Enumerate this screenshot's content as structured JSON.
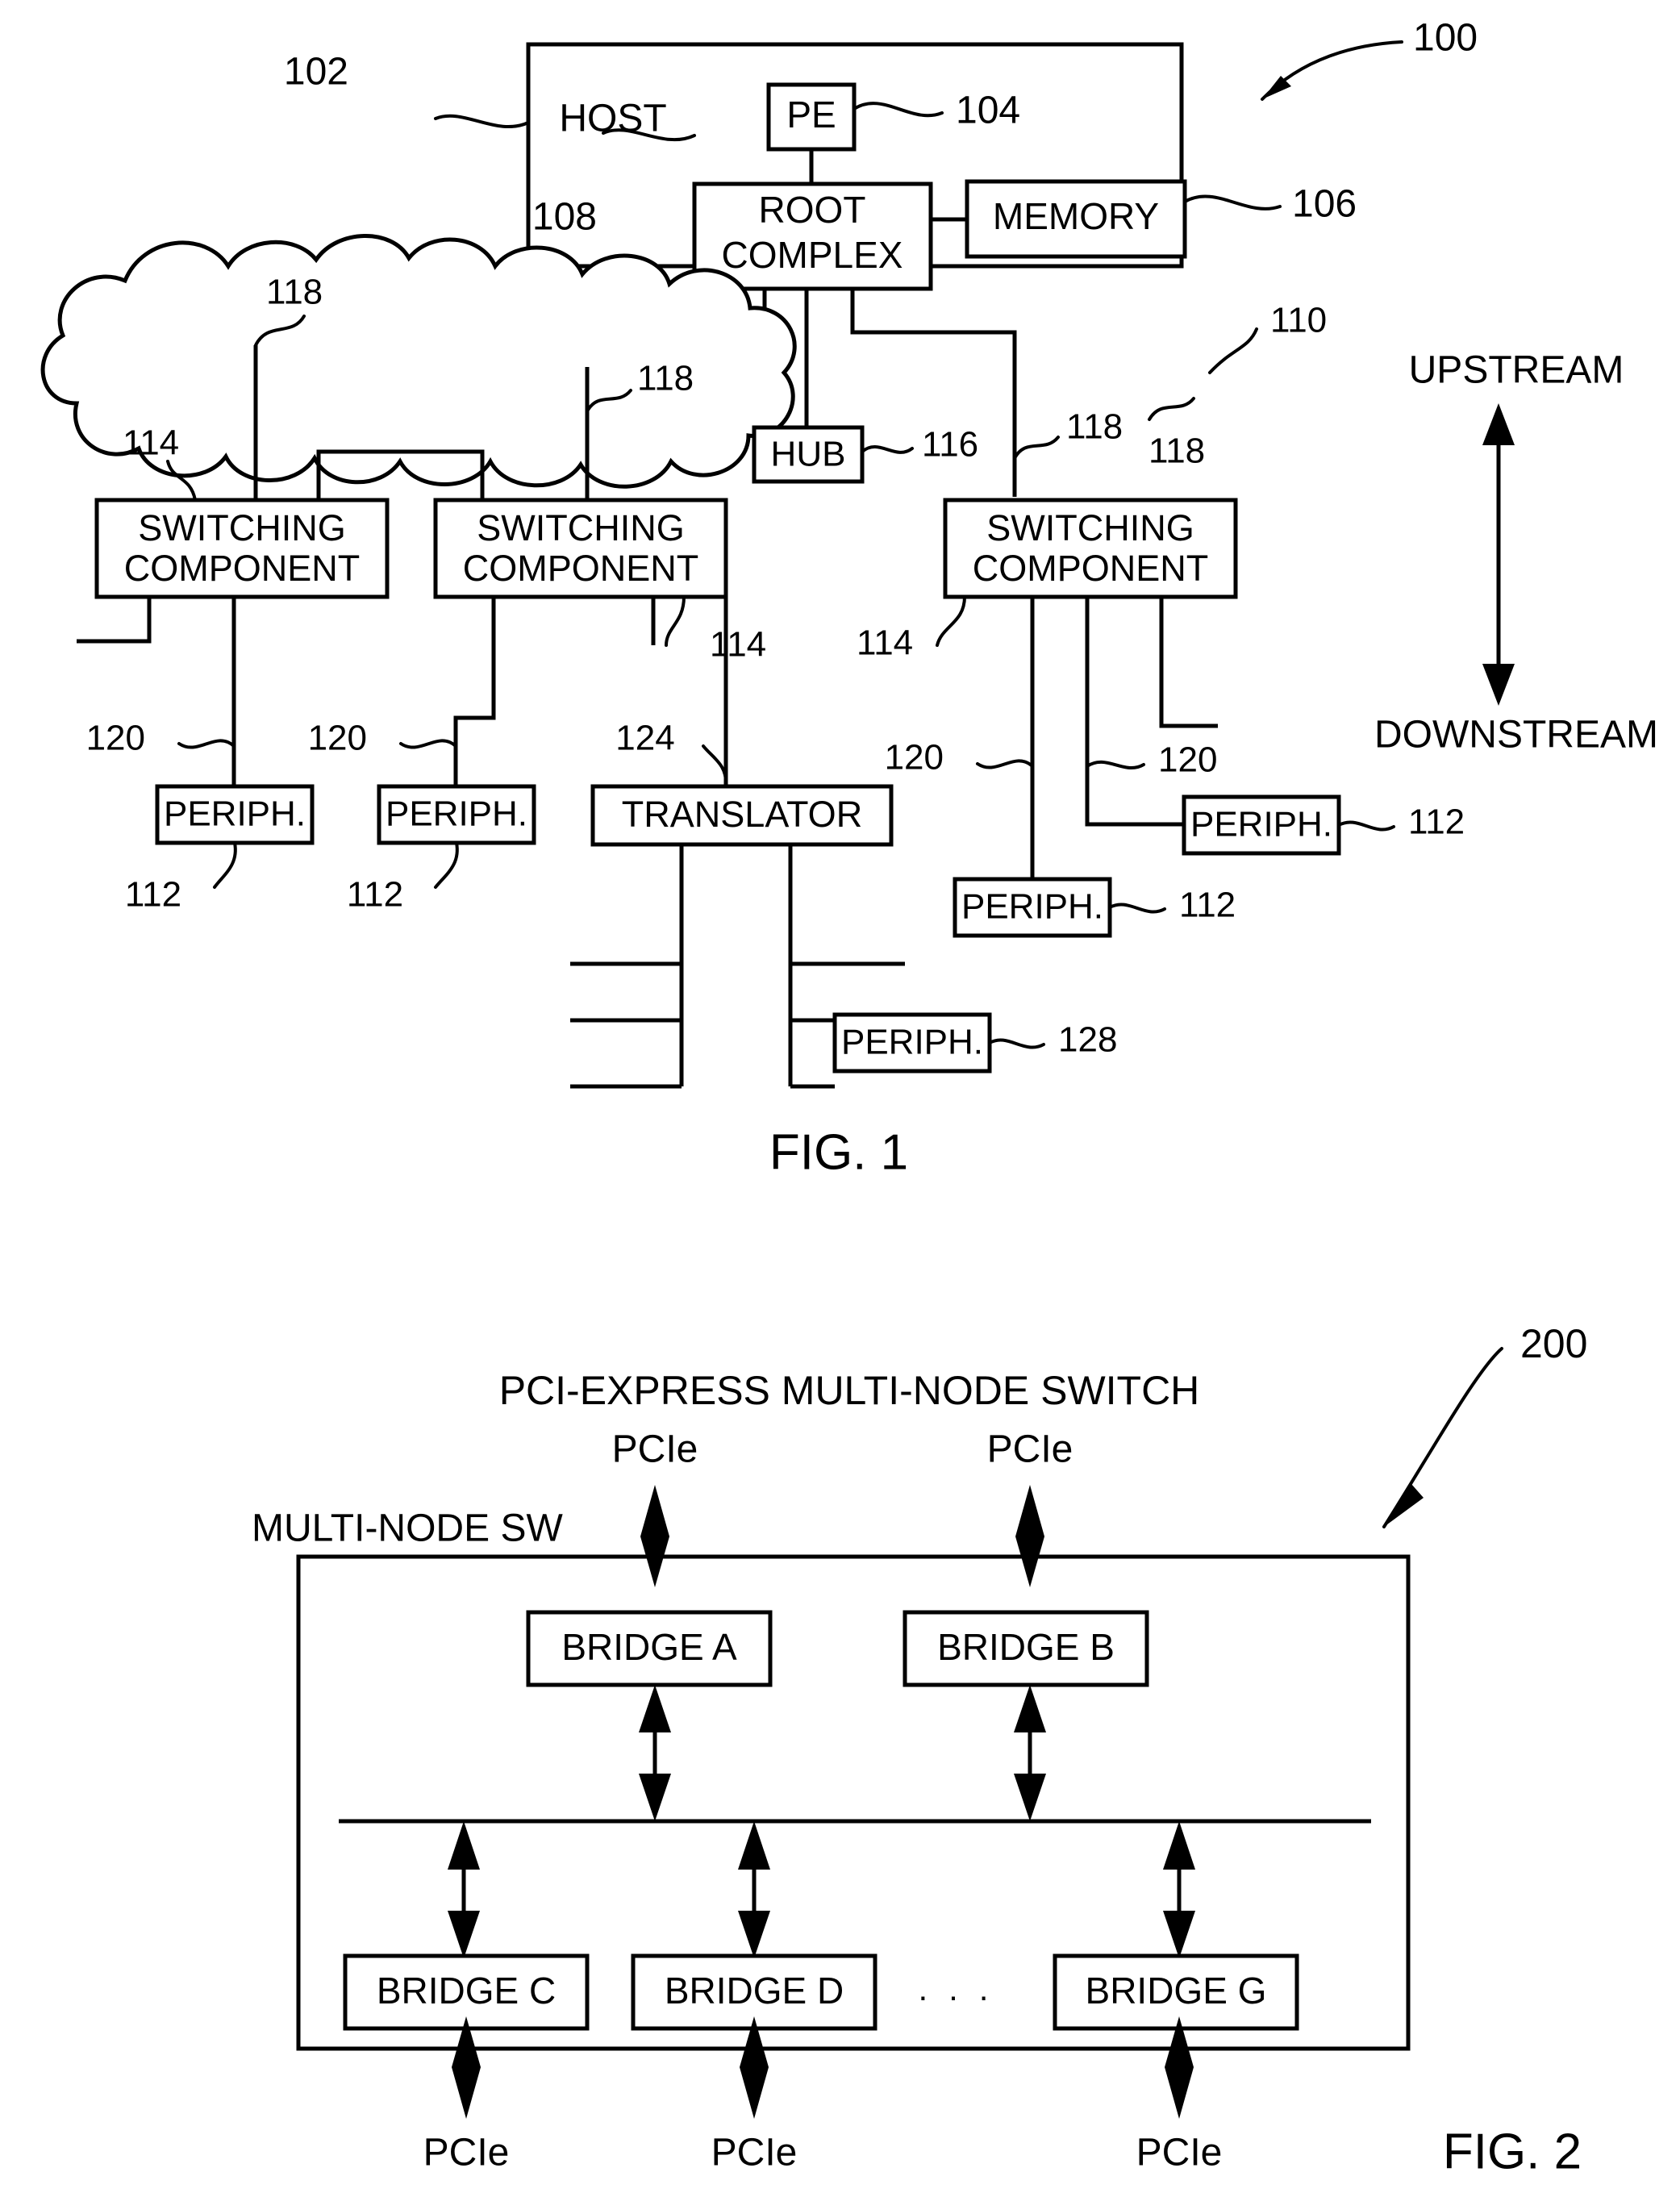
{
  "figure1": {
    "caption": "FIG. 1",
    "ref_system": "100",
    "host": {
      "label": "HOST",
      "ref": "102"
    },
    "pe": {
      "label": "PE",
      "ref": "104"
    },
    "root_complex": {
      "label_line1": "ROOT",
      "label_line2": "COMPLEX",
      "ref": "108"
    },
    "memory": {
      "label": "MEMORY",
      "ref": "106"
    },
    "fabric": {
      "ref": "110"
    },
    "hub": {
      "label": "HUB",
      "ref": "116"
    },
    "switching_components": [
      {
        "label_line1": "SWITCHING",
        "label_line2": "COMPONENT",
        "ref": "114"
      },
      {
        "label_line1": "SWITCHING",
        "label_line2": "COMPONENT",
        "ref": "114"
      },
      {
        "label_line1": "SWITCHING",
        "label_line2": "COMPONENT",
        "ref": "114"
      }
    ],
    "link_refs_upstream": [
      "118",
      "118",
      "118",
      "118"
    ],
    "link_refs_downstream": [
      "120",
      "120",
      "120",
      "120"
    ],
    "peripherals": [
      {
        "label": "PERIPH.",
        "ref": "112"
      },
      {
        "label": "PERIPH.",
        "ref": "112"
      },
      {
        "label": "PERIPH.",
        "ref": "112"
      },
      {
        "label": "PERIPH.",
        "ref": "112"
      },
      {
        "label": "PERIPH.",
        "ref": "128"
      }
    ],
    "translator": {
      "label": "TRANSLATOR",
      "ref": "124"
    },
    "direction": {
      "upstream": "UPSTREAM",
      "downstream": "DOWNSTREAM"
    }
  },
  "figure2": {
    "caption": "FIG. 2",
    "ref_system": "200",
    "title": "PCI-EXPRESS MULTI-NODE SWITCH",
    "switch_label": "MULTI-NODE SW",
    "bridges_top": [
      {
        "label": "BRIDGE A"
      },
      {
        "label": "BRIDGE B"
      }
    ],
    "bridges_bottom": [
      {
        "label": "BRIDGE C"
      },
      {
        "label": "BRIDGE D"
      },
      {
        "label": "BRIDGE G"
      }
    ],
    "ellipsis": "·   ·   ·",
    "pcie_top": [
      "PCIe",
      "PCIe"
    ],
    "pcie_bottom": [
      "PCIe",
      "PCIe",
      "PCIe"
    ]
  },
  "colors": {
    "ink": "#000000",
    "paper": "#ffffff"
  }
}
